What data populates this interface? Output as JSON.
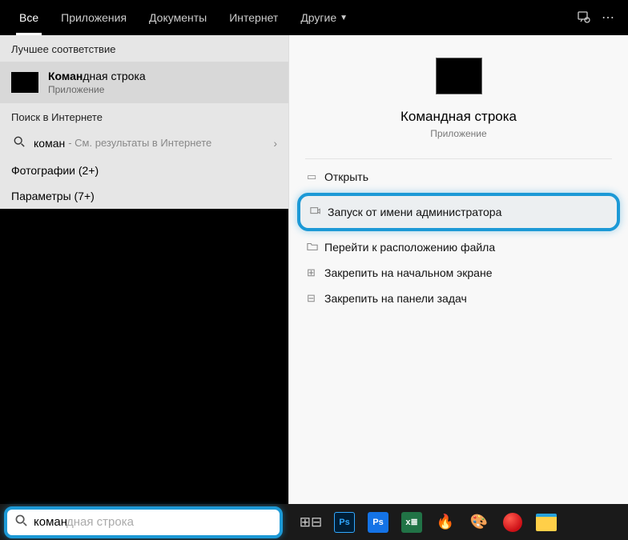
{
  "tabs": {
    "all": "Все",
    "apps": "Приложения",
    "docs": "Документы",
    "web": "Интернет",
    "other": "Другие"
  },
  "left": {
    "best_header": "Лучшее соответствие",
    "best_title_bold": "Коман",
    "best_title_rest": "дная строка",
    "best_sub": "Приложение",
    "web_header": "Поиск в Интернете",
    "web_term": "коман",
    "web_hint": " - См. результаты в Интернете",
    "photos": "Фотографии (2+)",
    "params": "Параметры (7+)"
  },
  "preview": {
    "title": "Командная строка",
    "sub": "Приложение"
  },
  "actions": {
    "open": "Открыть",
    "runas": "Запуск от имени администратора",
    "location": "Перейти к расположению файла",
    "pin_start": "Закрепить на начальном экране",
    "pin_task": "Закрепить на панели задач"
  },
  "search": {
    "typed": "коман",
    "completion": "дная строка"
  },
  "icons": {
    "feedback": "feedback-icon",
    "more": "more-icon",
    "search": "search-icon",
    "chevron_down": "chevron-down-icon",
    "chevron_right": "chevron-right-icon",
    "open": "open-icon",
    "admin": "shield-admin-icon",
    "folder": "folder-open-icon",
    "pin_start": "pin-start-icon",
    "pin_task": "pin-taskbar-icon",
    "taskview": "task-view-icon"
  }
}
